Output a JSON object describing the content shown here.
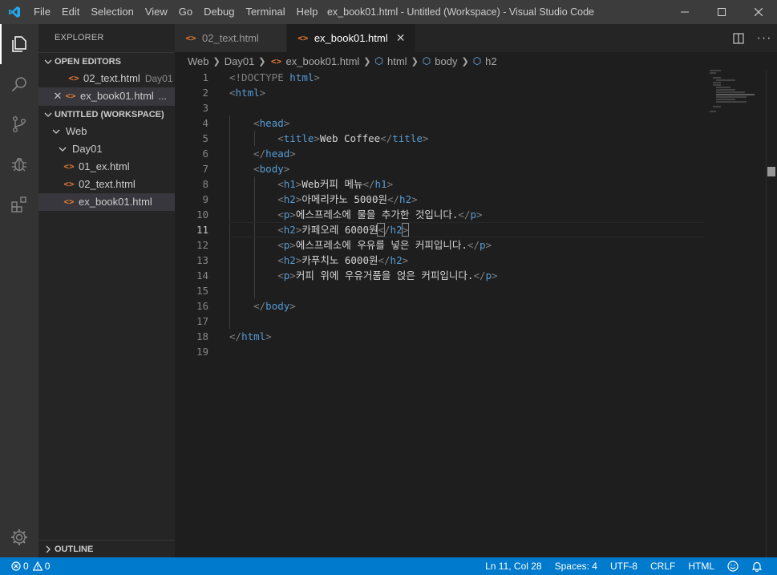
{
  "window": {
    "title": "ex_book01.html - Untitled (Workspace) - Visual Studio Code",
    "menu": [
      "File",
      "Edit",
      "Selection",
      "View",
      "Go",
      "Debug",
      "Terminal",
      "Help"
    ]
  },
  "sidebar": {
    "title": "EXPLORER",
    "open_editors_label": "OPEN EDITORS",
    "open_editors": [
      {
        "name": "02_text.html",
        "desc": "Day01"
      },
      {
        "name": "ex_book01.html",
        "desc": "..."
      }
    ],
    "workspace_label": "UNTITLED (WORKSPACE)",
    "folder_web": "Web",
    "folder_day01": "Day01",
    "files": [
      "01_ex.html",
      "02_text.html",
      "ex_book01.html"
    ],
    "outline_label": "OUTLINE"
  },
  "tabs": [
    {
      "label": "02_text.html",
      "active": false
    },
    {
      "label": "ex_book01.html",
      "active": true
    }
  ],
  "breadcrumb": {
    "items": [
      "Web",
      "Day01",
      "ex_book01.html",
      "html",
      "body",
      "h2"
    ]
  },
  "editor": {
    "line_numbers": [
      "1",
      "2",
      "3",
      "4",
      "5",
      "6",
      "7",
      "8",
      "9",
      "10",
      "11",
      "12",
      "13",
      "14",
      "15",
      "16",
      "17",
      "18",
      "19"
    ],
    "texts": {
      "l5": "Web Coffee",
      "l8": "Web커피 메뉴",
      "l9": "아메리카노 5000원",
      "l10": "에스프레소에 물을 추가한 것입니다.",
      "l11": "카페오레 6000원",
      "l12": "에스프레소에 우유를 넣은 커피입니다.",
      "l13": "카푸치노 6000원",
      "l14": "커피 위에 우유거품을 얹은 커피입니다."
    }
  },
  "status": {
    "errors": "0",
    "warnings": "0",
    "position": "Ln 11, Col 28",
    "spaces": "Spaces: 4",
    "encoding": "UTF-8",
    "eol": "CRLF",
    "language": "HTML"
  },
  "colors": {
    "statusbar": "#007acc",
    "tag": "#569cd6",
    "file_icon": "#e37933"
  }
}
